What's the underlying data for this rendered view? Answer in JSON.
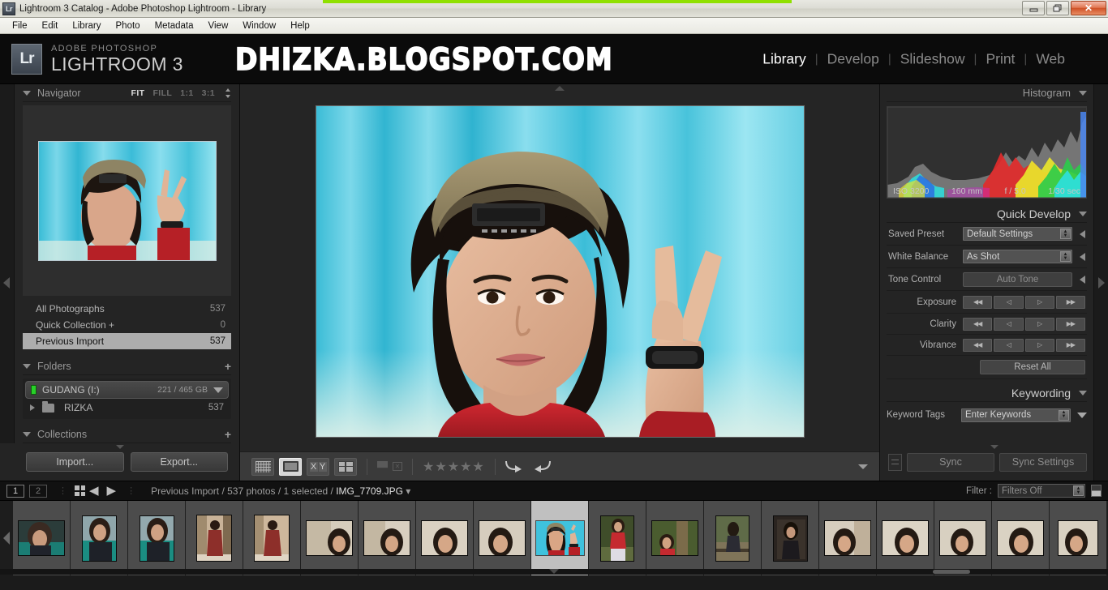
{
  "window": {
    "title": "Lightroom 3 Catalog - Adobe Photoshop Lightroom - Library",
    "app_icon": "Lr",
    "minimize": "–",
    "restore": "❐",
    "close": "✕"
  },
  "menubar": {
    "items": [
      "File",
      "Edit",
      "Library",
      "Photo",
      "Metadata",
      "View",
      "Window",
      "Help"
    ]
  },
  "identity": {
    "badge": "Lr",
    "brand_small": "ADOBE PHOTOSHOP",
    "brand_big": "LIGHTROOM 3",
    "watermark": "DHIZKA.BLOGSPOT.COM"
  },
  "modules": {
    "items": [
      {
        "label": "Library",
        "active": true
      },
      {
        "label": "Develop",
        "active": false
      },
      {
        "label": "Slideshow",
        "active": false
      },
      {
        "label": "Print",
        "active": false
      },
      {
        "label": "Web",
        "active": false
      }
    ],
    "separator": "|"
  },
  "left_panel": {
    "navigator": {
      "title": "Navigator",
      "zoom_levels": [
        {
          "label": "FIT",
          "active": true
        },
        {
          "label": "FILL",
          "active": false
        },
        {
          "label": "1:1",
          "active": false
        },
        {
          "label": "3:1",
          "active": false
        }
      ]
    },
    "catalog": {
      "rows": [
        {
          "label": "All Photographs",
          "count": "537",
          "selected": false
        },
        {
          "label": "Quick Collection  +",
          "count": "0",
          "selected": false
        },
        {
          "label": "Previous Import",
          "count": "537",
          "selected": true
        }
      ]
    },
    "folders": {
      "title": "Folders",
      "add": "+",
      "volume": {
        "name": "GUDANG (I:)",
        "size": "221 / 465 GB"
      },
      "items": [
        {
          "label": "RIZKA",
          "count": "537"
        }
      ]
    },
    "collections": {
      "title": "Collections",
      "add": "+"
    },
    "buttons": {
      "import": "Import...",
      "export": "Export..."
    }
  },
  "toolbar": {
    "view_modes": [
      {
        "name": "grid-view",
        "active": false
      },
      {
        "name": "loupe-view",
        "active": true
      },
      {
        "name": "compare-view",
        "active": false
      },
      {
        "name": "survey-view",
        "active": false
      }
    ],
    "flags": [
      "flag-pick",
      "flag-reject"
    ],
    "stars": "★★★★★",
    "star_count": 5,
    "rotate_left": "↳",
    "rotate_right": "↵"
  },
  "right_panel": {
    "histogram": {
      "title": "Histogram",
      "exif": {
        "iso": "ISO 3200",
        "focal": "160 mm",
        "aperture": "f / 5.0",
        "shutter": "1/30 sec"
      }
    },
    "quick_develop": {
      "title": "Quick Develop",
      "saved_preset": {
        "label": "Saved Preset",
        "value": "Default Settings"
      },
      "white_balance": {
        "label": "White Balance",
        "value": "As Shot"
      },
      "tone_control": {
        "label": "Tone Control",
        "button": "Auto Tone"
      },
      "sliders": [
        {
          "label": "Exposure"
        },
        {
          "label": "Clarity"
        },
        {
          "label": "Vibrance"
        }
      ],
      "stepper_icons": [
        "◀◀",
        "◁",
        "▷",
        "▶▶"
      ],
      "reset": "Reset All"
    },
    "keywording": {
      "title": "Keywording",
      "label": "Keyword Tags",
      "placeholder": "Enter Keywords"
    },
    "buttons": {
      "sync": "Sync",
      "sync_settings": "Sync Settings"
    }
  },
  "status_bar": {
    "page_buttons": [
      "1",
      "2"
    ],
    "prev_arrow": "◀",
    "next_arrow": "▶",
    "breadcrumb_prefix": "Previous Import / 537 photos / 1 selected / ",
    "breadcrumb_file": "IMG_7709.JPG",
    "breadcrumb_caret": "▾",
    "filter_label": "Filter :",
    "filter_value": "Filters Off"
  },
  "filmstrip": {
    "thumbnails": [
      {
        "id": "t1",
        "orientation": "landscape",
        "selected": false,
        "theme": "dark-table"
      },
      {
        "id": "t2",
        "orientation": "portrait",
        "selected": false,
        "theme": "dark-table"
      },
      {
        "id": "t3",
        "orientation": "portrait",
        "selected": false,
        "theme": "dark-table"
      },
      {
        "id": "t4",
        "orientation": "portrait",
        "selected": false,
        "theme": "dress-room"
      },
      {
        "id": "t5",
        "orientation": "portrait",
        "selected": false,
        "theme": "dress-room"
      },
      {
        "id": "t6",
        "orientation": "landscape",
        "selected": false,
        "theme": "indoor-pale"
      },
      {
        "id": "t7",
        "orientation": "landscape",
        "selected": false,
        "theme": "indoor-pale"
      },
      {
        "id": "t8",
        "orientation": "landscape",
        "selected": false,
        "theme": "indoor-pale"
      },
      {
        "id": "t9",
        "orientation": "landscape",
        "selected": false,
        "theme": "indoor-pale"
      },
      {
        "id": "t10",
        "orientation": "landscape",
        "selected": true,
        "theme": "teal-peace"
      },
      {
        "id": "t11",
        "orientation": "portrait",
        "selected": false,
        "theme": "red-green"
      },
      {
        "id": "t12",
        "orientation": "landscape",
        "selected": false,
        "theme": "forest"
      },
      {
        "id": "t13",
        "orientation": "portrait",
        "selected": false,
        "theme": "rail-dark"
      },
      {
        "id": "t14",
        "orientation": "portrait",
        "selected": false,
        "theme": "studio-dark"
      },
      {
        "id": "t15",
        "orientation": "landscape",
        "selected": false,
        "theme": "indoor-pale"
      },
      {
        "id": "t16",
        "orientation": "landscape",
        "selected": false,
        "theme": "indoor-pale"
      },
      {
        "id": "t17",
        "orientation": "landscape",
        "selected": false,
        "theme": "indoor-pale"
      },
      {
        "id": "t18",
        "orientation": "landscape",
        "selected": false,
        "theme": "indoor-pale"
      },
      {
        "id": "t19",
        "orientation": "landscape",
        "selected": false,
        "theme": "indoor-pale"
      }
    ]
  },
  "colors": {
    "panel_bg": "#242424",
    "center_bg": "#252525",
    "accent_text": "#ffffff",
    "selection": "#adadad",
    "volume_led": "#28d028"
  }
}
